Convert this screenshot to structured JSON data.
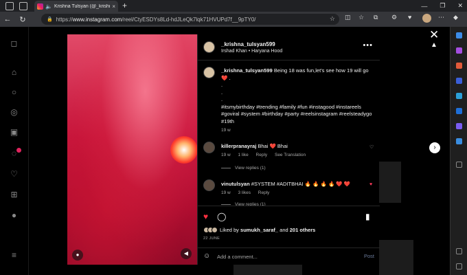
{
  "browser": {
    "tab_title": "Krishna Tulsyan (@_krishna...",
    "tab_close": "×",
    "new_tab": "+",
    "url_prefix": "https://",
    "url_host": "www.instagram.com",
    "url_path": "/reel/CtyESDYs8Ld-hdJLeQk7lqk71HVUPd7f__9pTY0/",
    "window_controls": [
      "—",
      "❐",
      "✕"
    ]
  },
  "post": {
    "username": "_krishna_tulsyan599",
    "audio": "Irshad Khan • Haryana Hood",
    "more": "•••",
    "caption_text": "Being 18 was fun,let's see how 19 will go",
    "caption_heart": "❤️",
    "caption_dots": [
      ".",
      ".",
      ".",
      "."
    ],
    "hashtags": "#itsmybirthday #trending #family #fun #instagood #instareels #goviral #system #birthday #party #reelsinstagram #reelsteadygo #19th",
    "caption_time": "19 w"
  },
  "comments": [
    {
      "username": "killerpranayraj",
      "text": "Bhai ❤️ Bhai",
      "time": "19 w",
      "likes": "1 like",
      "reply": "Reply",
      "translate": "See Translation",
      "replies": "View replies (1)"
    },
    {
      "username": "vinutulsyan",
      "text": "#SYSTEM #ADITBHAI 🔥 🔥 🔥 🔥 ❤️ ❤️",
      "time": "19 w",
      "likes": "3 likes",
      "reply": "Reply",
      "replies": "View replies (1)"
    }
  ],
  "footer": {
    "liked_by_prefix": "Liked by",
    "liked_by_user": "sumukh_saraf_",
    "liked_by_and": "and",
    "liked_by_others": "201 others",
    "date": "22 JUNE",
    "add_comment_placeholder": "Add a comment...",
    "post_label": "Post"
  },
  "colors": {
    "like_red": "#ff3040",
    "post_disabled": "#6b7b9a"
  }
}
